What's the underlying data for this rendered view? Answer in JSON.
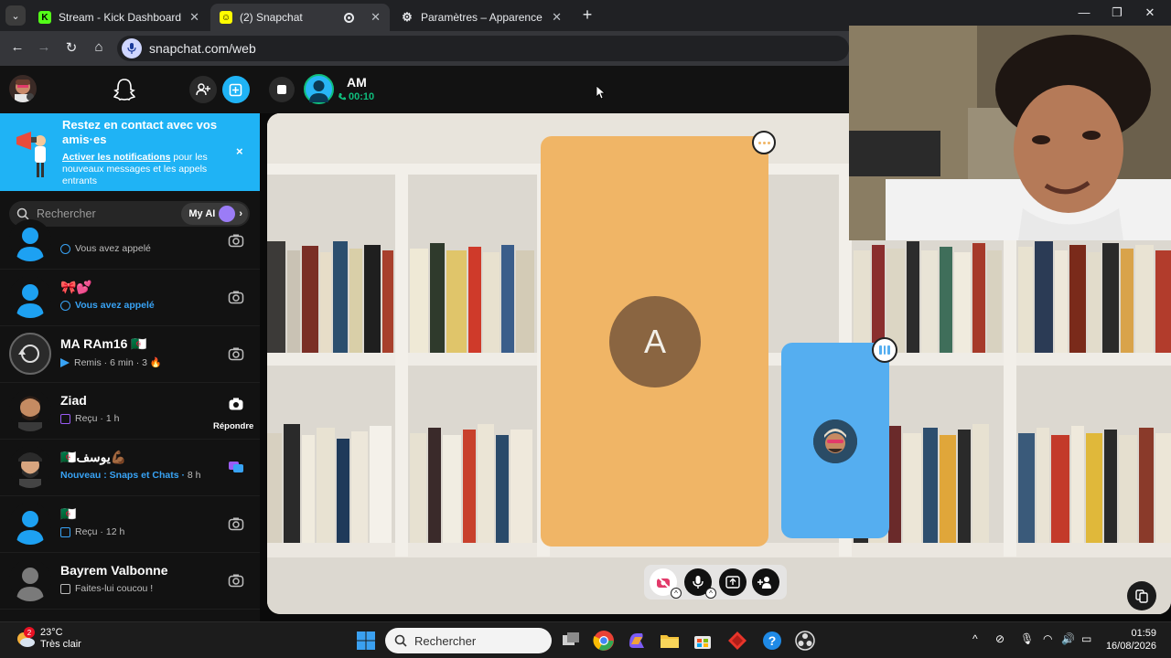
{
  "browser": {
    "tabs": [
      {
        "title": "Stream - Kick Dashboard",
        "favicon": "kick-logo"
      },
      {
        "title": "(2) Snapchat",
        "favicon": "snapchat-logo",
        "active": true
      },
      {
        "title": "Paramètres – Apparence",
        "favicon": "gear-icon"
      }
    ],
    "url": "snapchat.com/web"
  },
  "snap": {
    "banner": {
      "title": "Restez en contact avec vos amis·es",
      "link": "Activer les notifications",
      "body": " pour les nouveaux messages et les appels entrants",
      "close": "×"
    },
    "search_placeholder": "Rechercher",
    "myai_label": "My AI",
    "conversations": [
      {
        "name": "",
        "status": "Vous avez appelé",
        "status_kind": "called",
        "avatar": "bitmoji-placeholder"
      },
      {
        "name": "🎀💕",
        "status": "Vous avez appelé",
        "status_kind": "called-new",
        "avatar": "bitmoji-placeholder"
      },
      {
        "name": "MA RAm16 🇩🇿",
        "status": "Remis",
        "time": "6 min",
        "streak": "3 🔥",
        "status_kind": "sent",
        "avatar": "story-ring"
      },
      {
        "name": "Ziad",
        "status": "Reçu",
        "time": "1 h",
        "status_kind": "received-snap",
        "action": "Répondre",
        "avatar": "bitmoji"
      },
      {
        "name": "🇩🇿يوسف💪🏾",
        "status": "Nouveau : Snaps et Chats",
        "time": "8 h",
        "status_kind": "new",
        "avatar": "bitmoji"
      },
      {
        "name": "🇩🇿",
        "status": "Reçu",
        "time": "12 h",
        "status_kind": "received-chat",
        "avatar": "bitmoji-placeholder"
      },
      {
        "name": "Bayrem Valbonne",
        "status": "Faites-lui coucou !",
        "status_kind": "wave",
        "avatar": "bitmoji-grey"
      }
    ],
    "call": {
      "name": "AM",
      "duration": "00:10",
      "participant_initial": "A"
    }
  },
  "taskbar": {
    "weather_temp": "23°C",
    "weather_desc": "Très clair",
    "weather_badge": "2",
    "search_placeholder": "Rechercher",
    "time": "01:59",
    "date": "16/08/2026"
  },
  "colors": {
    "snap_blue": "#1fb3f5",
    "call_green": "#0fbe7d",
    "tile_orange": "#f0b566",
    "tile_blue": "#55aef0"
  }
}
